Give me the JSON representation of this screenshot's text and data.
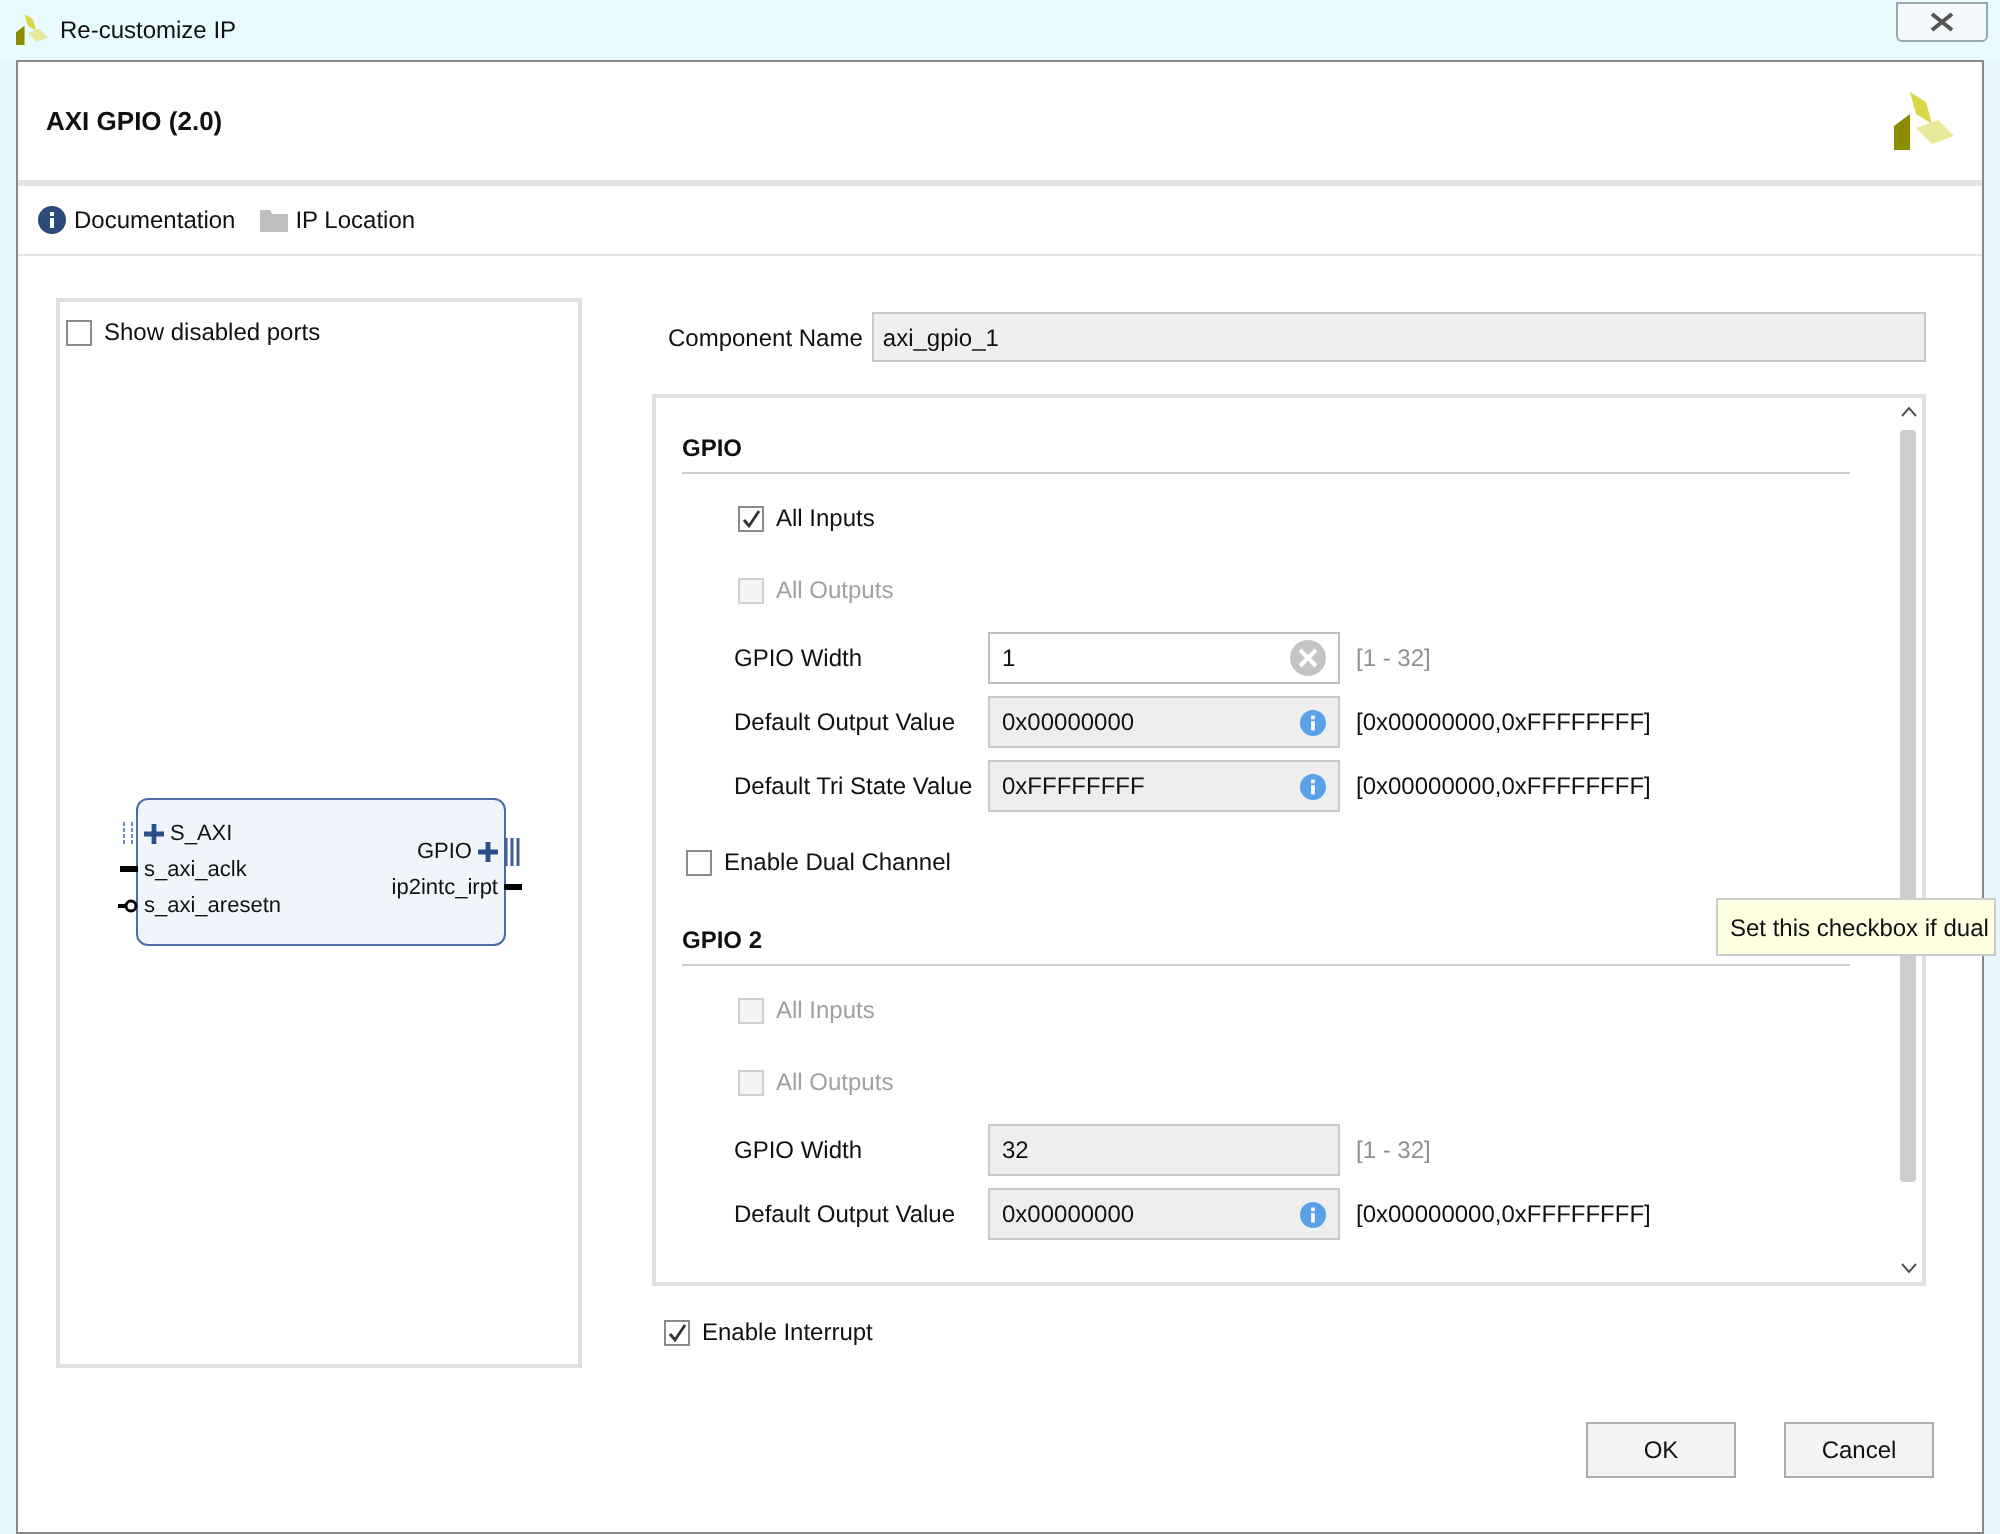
{
  "window": {
    "title": "Re-customize IP"
  },
  "header": {
    "title": "AXI GPIO (2.0)"
  },
  "toolbar": [
    {
      "kind": "info",
      "label": "Documentation"
    },
    {
      "kind": "folder",
      "label": "IP Location"
    }
  ],
  "left_panel": {
    "show_disabled_ports": {
      "label": "Show disabled ports",
      "checked": false
    },
    "block": {
      "left_ports": [
        {
          "kind": "bus",
          "label": "S_AXI"
        },
        {
          "kind": "wire",
          "label": "s_axi_aclk"
        },
        {
          "kind": "inverted",
          "label": "s_axi_aresetn"
        }
      ],
      "right_ports": [
        {
          "kind": "bus",
          "label": "GPIO"
        },
        {
          "kind": "wire",
          "label": "ip2intc_irpt"
        }
      ]
    }
  },
  "component_name": {
    "label": "Component Name",
    "value": "axi_gpio_1"
  },
  "sections": [
    {
      "title": "GPIO",
      "rows": [
        {
          "kind": "checkbox",
          "label": "All Inputs",
          "checked": true,
          "disabled": false
        },
        {
          "kind": "checkbox",
          "label": "All Outputs",
          "checked": false,
          "disabled": true
        },
        {
          "kind": "clearable-field",
          "label": "GPIO Width",
          "value": "1",
          "disabled": false,
          "range": "[1 - 32]",
          "range_dim": true
        },
        {
          "kind": "hex-field",
          "label": "Default Output Value",
          "value": "0x00000000",
          "disabled": true,
          "range": "[0x00000000,0xFFFFFFFF]",
          "range_dim": false
        },
        {
          "kind": "hex-field",
          "label": "Default Tri State Value",
          "value": "0xFFFFFFFF",
          "disabled": true,
          "range": "[0x00000000,0xFFFFFFFF]",
          "range_dim": false
        },
        {
          "kind": "outer-checkbox",
          "label": "Enable Dual Channel",
          "checked": false,
          "disabled": false
        }
      ]
    },
    {
      "title": "GPIO 2",
      "rows": [
        {
          "kind": "checkbox",
          "label": "All Inputs",
          "checked": false,
          "disabled": true
        },
        {
          "kind": "checkbox",
          "label": "All Outputs",
          "checked": false,
          "disabled": true
        },
        {
          "kind": "plain-field",
          "label": "GPIO Width",
          "value": "32",
          "disabled": true,
          "range": "[1 - 32]",
          "range_dim": true
        },
        {
          "kind": "hex-field",
          "label": "Default Output Value",
          "value": "0x00000000",
          "disabled": true,
          "range": "[0x00000000,0xFFFFFFFF]",
          "range_dim": false
        }
      ]
    }
  ],
  "tooltip": {
    "text": "Set this checkbox if dual"
  },
  "enable_interrupt": {
    "label": "Enable Interrupt",
    "checked": true
  },
  "buttons": [
    {
      "label": "OK"
    },
    {
      "label": "Cancel"
    }
  ]
}
